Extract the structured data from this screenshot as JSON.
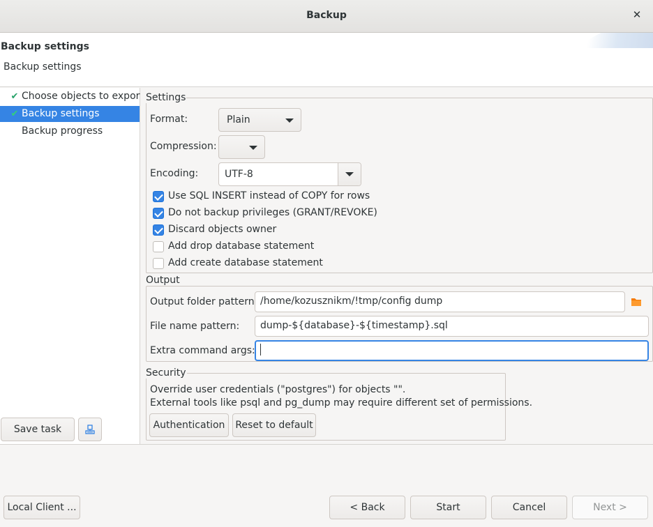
{
  "window": {
    "title": "Backup",
    "close_glyph": "✕"
  },
  "header": {
    "title": "Backup settings",
    "description": "Backup settings"
  },
  "nav": {
    "items": [
      {
        "label": "Choose objects to export",
        "checked": true,
        "selected": false
      },
      {
        "label": "Backup settings",
        "checked": true,
        "selected": true
      },
      {
        "label": "Backup progress",
        "checked": false,
        "selected": false
      }
    ],
    "check_glyph": "✔"
  },
  "settings": {
    "group_label": "Settings",
    "format_label": "Format:",
    "format_value": "Plain",
    "compression_label": "Compression:",
    "compression_value": "",
    "encoding_label": "Encoding:",
    "encoding_value": "UTF-8",
    "options": [
      {
        "label": "Use SQL INSERT instead of COPY for rows",
        "checked": true
      },
      {
        "label": "Do not backup privileges (GRANT/REVOKE)",
        "checked": true
      },
      {
        "label": "Discard objects owner",
        "checked": true
      },
      {
        "label": "Add drop database statement",
        "checked": false
      },
      {
        "label": "Add create database statement",
        "checked": false
      }
    ]
  },
  "output": {
    "group_label": "Output",
    "folder_label": "Output folder pattern:",
    "folder_value": "/home/kozusznikm/!tmp/config dump",
    "file_label": "File name pattern:",
    "file_value": "dump-${database}-${timestamp}.sql",
    "extra_label": "Extra command args:",
    "extra_value": ""
  },
  "security": {
    "group_label": "Security",
    "line1": "Override user credentials (\"postgres\") for objects \"\".",
    "line2": "External tools like psql and pg_dump may require different set of permissions.",
    "auth_button": "Authentication",
    "reset_button": "Reset to default"
  },
  "task": {
    "save_button": "Save task"
  },
  "footer": {
    "local_client": "Local Client ...",
    "back": "< Back",
    "start": "Start",
    "cancel": "Cancel",
    "next": "Next >"
  },
  "colors": {
    "accent": "#3584e4",
    "check": "#26a269",
    "folder": "#f57900"
  }
}
